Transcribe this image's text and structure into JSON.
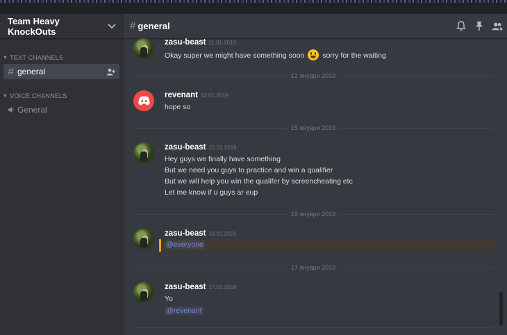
{
  "server": {
    "name": "Team Heavy KnockOuts"
  },
  "sidebar": {
    "text_category": "TEXT CHANNELS",
    "voice_category": "VOICE CHANNELS",
    "text_channels": [
      {
        "name": "general"
      }
    ],
    "voice_channels": [
      {
        "name": "General"
      }
    ]
  },
  "chat": {
    "channel_name": "general",
    "header_icons": [
      "bell-icon",
      "pin-icon",
      "members-icon"
    ]
  },
  "messages": [
    {
      "author": "zasu-beast",
      "timestamp": "11.01.2019",
      "avatar": "photo",
      "lines": [
        "Okay super we might have something soon",
        "sorry for the waiting"
      ],
      "emoji": "smiley"
    },
    {
      "divider": "12 януари 2019"
    },
    {
      "author": "revenant",
      "timestamp": "12.01.2019",
      "avatar": "discord-logo",
      "lines": [
        "hope so"
      ]
    },
    {
      "divider": "15 януари 2019"
    },
    {
      "author": "zasu-beast",
      "timestamp": "15.01.2019",
      "avatar": "photo",
      "lines": [
        "Hey guys we finally have something",
        "But we need you guys to practice and win a qualifier",
        "But we will help you win the qualifer by screencheating etc",
        "Let me know if u guys ar eup"
      ]
    },
    {
      "divider": "16 януари 2019"
    },
    {
      "author": "zasu-beast",
      "timestamp": "16.01.2019",
      "avatar": "photo",
      "mention": "@everyone"
    },
    {
      "divider": "17 януари 2019"
    },
    {
      "author": "zasu-beast",
      "timestamp": "17.01.2019",
      "avatar": "photo",
      "lines": [
        "Yo"
      ],
      "mention": "@revenant"
    }
  ],
  "colors": {
    "accent_mention": "#7289da",
    "highlight_bar": "#faa61a",
    "discord_red": "#f04747"
  }
}
